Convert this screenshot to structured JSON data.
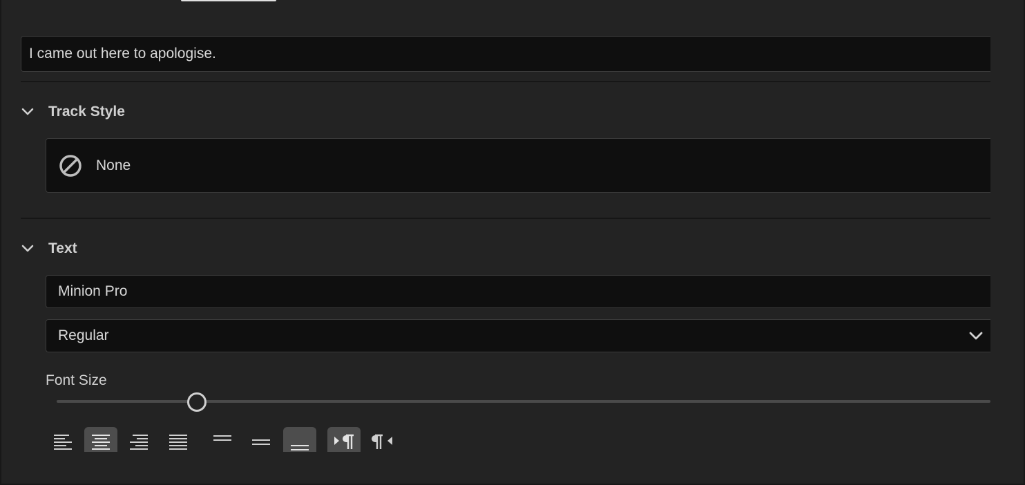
{
  "caption": {
    "text": "I came out here to apologise."
  },
  "track_style": {
    "title": "Track Style",
    "value": "None",
    "icon": "none-circle-slash-icon"
  },
  "text_section": {
    "title": "Text",
    "font_family": "Minion Pro",
    "font_style": "Regular",
    "font_size_label": "Font Size",
    "font_size_slider_fraction": 0.15
  },
  "alignment_buttons": [
    {
      "name": "align-left",
      "icon": "align-left-icon",
      "active": false
    },
    {
      "name": "align-center",
      "icon": "align-center-icon",
      "active": true
    },
    {
      "name": "align-right",
      "icon": "align-right-icon",
      "active": false
    },
    {
      "name": "justify",
      "icon": "justify-icon",
      "active": false
    },
    {
      "name": "align-top",
      "icon": "align-top-icon",
      "active": false
    },
    {
      "name": "align-middle",
      "icon": "align-middle-icon",
      "active": false
    },
    {
      "name": "align-bottom",
      "icon": "align-bottom-icon",
      "active": true
    },
    {
      "name": "left-to-right",
      "icon": "ltr-paragraph-icon",
      "active": true
    },
    {
      "name": "right-to-left",
      "icon": "rtl-paragraph-icon",
      "active": false
    }
  ],
  "colors": {
    "panel_bg": "#232323",
    "field_bg": "#0f0f0f",
    "active_button": "#4d4d4d"
  }
}
